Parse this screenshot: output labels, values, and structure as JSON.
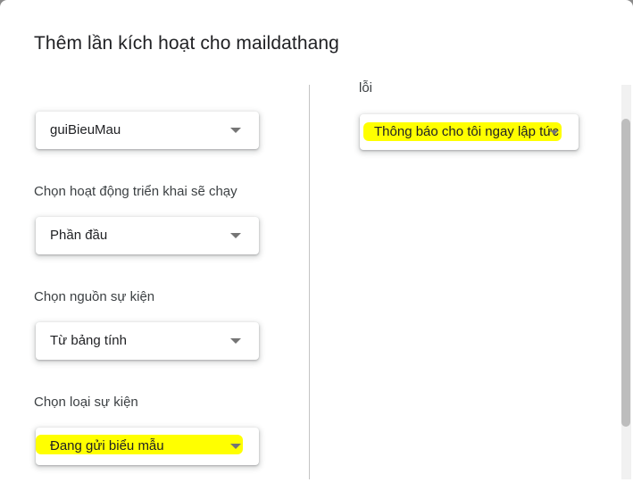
{
  "dialog": {
    "title": "Thêm lần kích hoạt cho maildathang"
  },
  "left": {
    "function_select": {
      "value": "guiBieuMau"
    },
    "deployment": {
      "label": "Chọn hoạt động triển khai sẽ chạy",
      "value": "Phần đầu"
    },
    "event_source": {
      "label": "Chọn nguồn sự kiện",
      "value": "Từ bảng tính"
    },
    "event_type": {
      "label": "Chọn loại sự kiện",
      "value": "Đang gửi biểu mẫu"
    }
  },
  "right": {
    "failure_label": "lỗi",
    "notification_select": {
      "value": "Thông báo cho tôi ngay lập tức"
    }
  },
  "colors": {
    "highlight": "#ffff00",
    "text": "#202124",
    "caret": "#757575"
  }
}
